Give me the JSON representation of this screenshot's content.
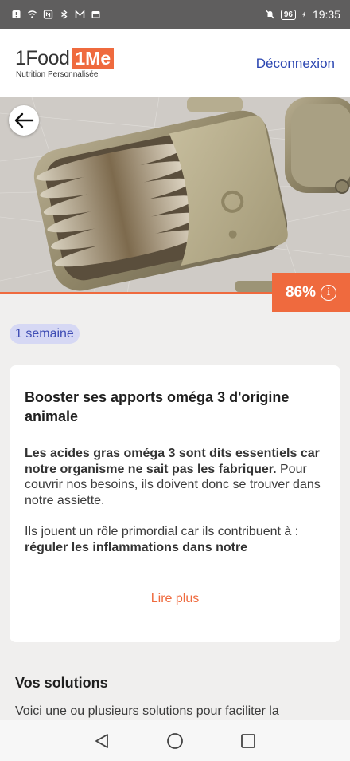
{
  "status_bar": {
    "time": "19:35",
    "battery": "96",
    "icons_left": [
      "notification-icon",
      "wifi-icon",
      "nfc-icon",
      "bluetooth-icon",
      "mail-icon",
      "calendar-icon"
    ],
    "icons_right": [
      "mute-icon",
      "battery-icon",
      "charging-icon"
    ]
  },
  "header": {
    "logo_part1": "1Food",
    "logo_part2": "1Me",
    "logo_subtitle": "Nutrition Personnalisée",
    "logout_label": "Déconnexion"
  },
  "hero": {
    "score": "86%",
    "info_symbol": "i"
  },
  "duration_badge": "1 semaine",
  "card": {
    "title": "Booster ses apports oméga 3 d'origine animale",
    "para1_bold": "Les acides gras oméga 3 sont dits essentiels car notre organisme ne sait pas les fabriquer.",
    "para1_rest": "Pour couvrir nos besoins, ils doivent donc se trouver dans notre assiette.",
    "para2": "Ils jouent un rôle primordial car ils contribuent à :",
    "para3_bold": "réguler les inflammations dans notre",
    "read_more": "Lire plus"
  },
  "solutions": {
    "title": "Vos solutions",
    "text": "Voici une ou plusieurs solutions pour faciliter la"
  },
  "colors": {
    "accent": "#ef6a3e",
    "link": "#2b46b1",
    "badge_bg": "#d6d8f4",
    "badge_text": "#3e4cb4"
  }
}
